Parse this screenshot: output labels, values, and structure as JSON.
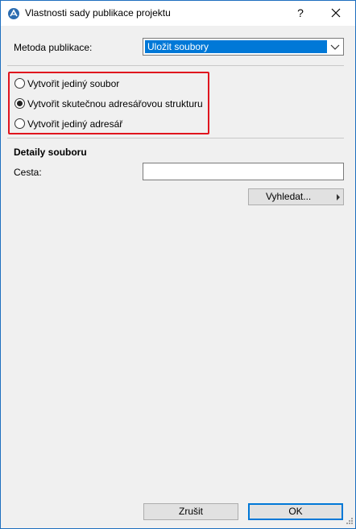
{
  "window": {
    "title": "Vlastnosti sady publikace projektu",
    "help_label": "?"
  },
  "publish_method": {
    "label": "Metoda publikace:",
    "selected": "Uložit soubory"
  },
  "options": [
    {
      "label": "Vytvořit jediný soubor",
      "checked": false
    },
    {
      "label": "Vytvořit skutečnou adresářovou strukturu",
      "checked": true
    },
    {
      "label": "Vytvořit jediný adresář",
      "checked": false
    }
  ],
  "file_details": {
    "heading": "Detaily souboru",
    "path_label": "Cesta:",
    "path_value": "",
    "browse_label": "Vyhledat..."
  },
  "footer": {
    "cancel_label": "Zrušit",
    "ok_label": "OK"
  },
  "colors": {
    "highlight_border": "#e0141e",
    "selection": "#0078d7"
  }
}
